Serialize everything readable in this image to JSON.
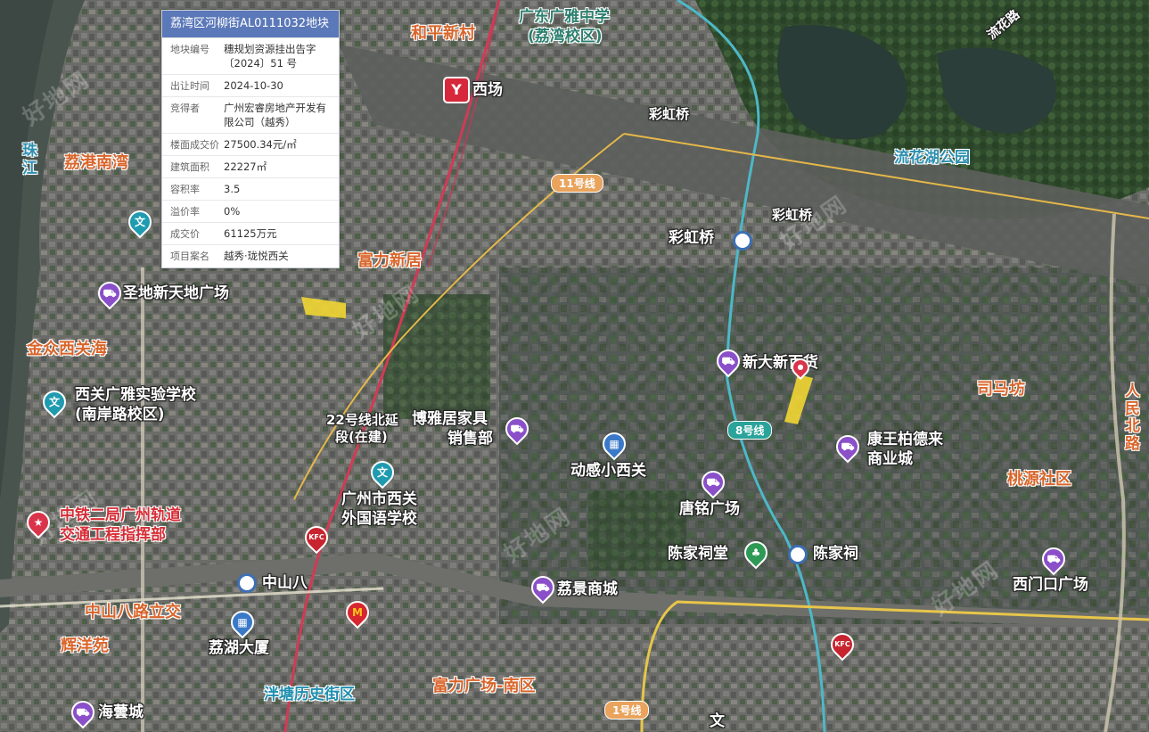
{
  "card": {
    "title": "荔湾区河柳街AL0111032地块",
    "rows": [
      {
        "k": "地块编号",
        "v": "穗规划资源挂出告字〔2024〕51 号"
      },
      {
        "k": "出让时间",
        "v": "2024-10-30"
      },
      {
        "k": "竞得者",
        "v": "广州宏睿房地产开发有限公司（越秀）"
      },
      {
        "k": "楼面成交价",
        "v": "27500.34元/㎡"
      },
      {
        "k": "建筑面积",
        "v": "22227㎡"
      },
      {
        "k": "容积率",
        "v": "3.5"
      },
      {
        "k": "溢价率",
        "v": "0%"
      },
      {
        "k": "成交价",
        "v": "61125万元"
      },
      {
        "k": "项目案名",
        "v": "越秀·珑悦西关"
      }
    ]
  },
  "labels": {
    "heping": "和平新村",
    "guangya1": "广东广雅中学",
    "guangya2": "(荔湾校区)",
    "xichang": "西场",
    "caihongqiao_road": "彩虹桥",
    "liuhua": "流花湖公园",
    "caihongqiao_pt": "彩虹桥",
    "caihongqiao_st": "彩虹桥",
    "zhujiang": "珠江",
    "ligangnanwan": "荔港南湾",
    "fulixinju": "富力新居",
    "shengdi": "圣地新天地广场",
    "jinzhong": "金众西关海",
    "xiguan1": "西关广雅实验学校",
    "xiguan2": "(南岸路校区)",
    "line22a": "22号线北延",
    "line22b": "段(在建)",
    "boya1": "博雅居家具",
    "boya2": "销售部",
    "donggan": "动感小西关",
    "xinda": "新大新百货",
    "simafang": "司马坊",
    "kangwang1": "康王柏德来",
    "kangwang2": "商业城",
    "renmin": "人民北路",
    "taoyuan": "桃源社区",
    "zhongtie1": "中铁二局广州轨道",
    "zhongtie2": "交通工程指挥部",
    "waiguoyu1": "广州市西关",
    "waiguoyu2": "外国语学校",
    "tangming": "唐铭广场",
    "chenjiacitang": "陈家祠堂",
    "chenjiaci": "陈家祠",
    "ximenkou": "西门口广场",
    "zhongshanba": "中山八",
    "lijing": "荔景商城",
    "zhongshanbalu": "中山八路立交",
    "huiyang": "辉洋苑",
    "lihu": "荔湖大厦",
    "yangtang": "泮塘历史街区",
    "fuli_nan": "富力广场-南区",
    "haiyun": "海蕓城",
    "liuhuaroad": "流花路",
    "wen": "文"
  },
  "lines": {
    "l11": "11号线",
    "l8": "8号线",
    "l1": "1号线"
  },
  "pins": {
    "shop": "⛟",
    "school": "文",
    "kfc": "KFC",
    "mcd": "M",
    "office": "▦",
    "park": "♣",
    "loc": "●"
  },
  "watermark": "好地网"
}
